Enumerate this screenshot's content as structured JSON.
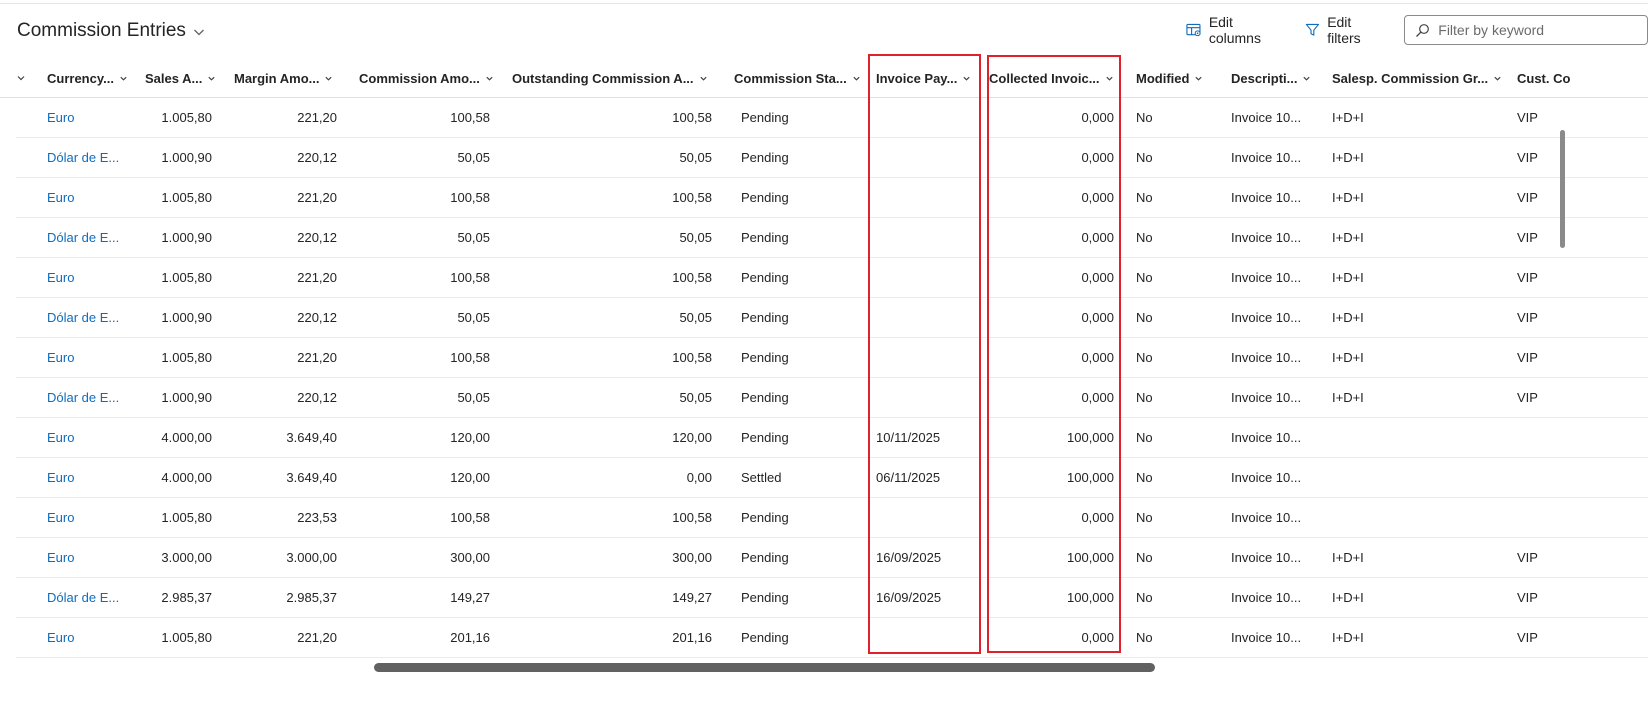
{
  "page": {
    "title": "Commission Entries"
  },
  "toolbar": {
    "edit_columns_label": "Edit columns",
    "edit_filters_label": "Edit filters",
    "filter_placeholder": "Filter by keyword",
    "filter_value": ""
  },
  "colors": {
    "link": "#0f6cbd",
    "highlight": "#e0212b"
  },
  "columns": [
    {
      "key": "currency",
      "label": "Currency..."
    },
    {
      "key": "sales",
      "label": "Sales A..."
    },
    {
      "key": "margin",
      "label": "Margin Amo..."
    },
    {
      "key": "commission",
      "label": "Commission Amo..."
    },
    {
      "key": "outstanding",
      "label": "Outstanding Commission A..."
    },
    {
      "key": "status",
      "label": "Commission Sta..."
    },
    {
      "key": "invoice_pay",
      "label": "Invoice Pay..."
    },
    {
      "key": "collected",
      "label": "Collected Invoic..."
    },
    {
      "key": "modified",
      "label": "Modified"
    },
    {
      "key": "description",
      "label": "Descripti..."
    },
    {
      "key": "group",
      "label": "Salesp. Commission Gr..."
    },
    {
      "key": "cust",
      "label": "Cust. Co"
    }
  ],
  "rows": [
    {
      "currency": "Euro",
      "sales": "1.005,80",
      "margin": "221,20",
      "commission": "100,58",
      "outstanding": "100,58",
      "status": "Pending",
      "invoice_pay": "",
      "collected": "0,000",
      "modified": "No",
      "description": "Invoice 10...",
      "group": "I+D+I",
      "cust": "VIP"
    },
    {
      "currency": "Dólar de E...",
      "sales": "1.000,90",
      "margin": "220,12",
      "commission": "50,05",
      "outstanding": "50,05",
      "status": "Pending",
      "invoice_pay": "",
      "collected": "0,000",
      "modified": "No",
      "description": "Invoice 10...",
      "group": "I+D+I",
      "cust": "VIP"
    },
    {
      "currency": "Euro",
      "sales": "1.005,80",
      "margin": "221,20",
      "commission": "100,58",
      "outstanding": "100,58",
      "status": "Pending",
      "invoice_pay": "",
      "collected": "0,000",
      "modified": "No",
      "description": "Invoice 10...",
      "group": "I+D+I",
      "cust": "VIP"
    },
    {
      "currency": "Dólar de E...",
      "sales": "1.000,90",
      "margin": "220,12",
      "commission": "50,05",
      "outstanding": "50,05",
      "status": "Pending",
      "invoice_pay": "",
      "collected": "0,000",
      "modified": "No",
      "description": "Invoice 10...",
      "group": "I+D+I",
      "cust": "VIP"
    },
    {
      "currency": "Euro",
      "sales": "1.005,80",
      "margin": "221,20",
      "commission": "100,58",
      "outstanding": "100,58",
      "status": "Pending",
      "invoice_pay": "",
      "collected": "0,000",
      "modified": "No",
      "description": "Invoice 10...",
      "group": "I+D+I",
      "cust": "VIP"
    },
    {
      "currency": "Dólar de E...",
      "sales": "1.000,90",
      "margin": "220,12",
      "commission": "50,05",
      "outstanding": "50,05",
      "status": "Pending",
      "invoice_pay": "",
      "collected": "0,000",
      "modified": "No",
      "description": "Invoice 10...",
      "group": "I+D+I",
      "cust": "VIP"
    },
    {
      "currency": "Euro",
      "sales": "1.005,80",
      "margin": "221,20",
      "commission": "100,58",
      "outstanding": "100,58",
      "status": "Pending",
      "invoice_pay": "",
      "collected": "0,000",
      "modified": "No",
      "description": "Invoice 10...",
      "group": "I+D+I",
      "cust": "VIP"
    },
    {
      "currency": "Dólar de E...",
      "sales": "1.000,90",
      "margin": "220,12",
      "commission": "50,05",
      "outstanding": "50,05",
      "status": "Pending",
      "invoice_pay": "",
      "collected": "0,000",
      "modified": "No",
      "description": "Invoice 10...",
      "group": "I+D+I",
      "cust": "VIP"
    },
    {
      "currency": "Euro",
      "sales": "4.000,00",
      "margin": "3.649,40",
      "commission": "120,00",
      "outstanding": "120,00",
      "status": "Pending",
      "invoice_pay": "10/11/2025",
      "collected": "100,000",
      "modified": "No",
      "description": "Invoice 10...",
      "group": "",
      "cust": ""
    },
    {
      "currency": "Euro",
      "sales": "4.000,00",
      "margin": "3.649,40",
      "commission": "120,00",
      "outstanding": "0,00",
      "status": "Settled",
      "invoice_pay": "06/11/2025",
      "collected": "100,000",
      "modified": "No",
      "description": "Invoice 10...",
      "group": "",
      "cust": ""
    },
    {
      "currency": "Euro",
      "sales": "1.005,80",
      "margin": "223,53",
      "commission": "100,58",
      "outstanding": "100,58",
      "status": "Pending",
      "invoice_pay": "",
      "collected": "0,000",
      "modified": "No",
      "description": "Invoice 10...",
      "group": "",
      "cust": ""
    },
    {
      "currency": "Euro",
      "sales": "3.000,00",
      "margin": "3.000,00",
      "commission": "300,00",
      "outstanding": "300,00",
      "status": "Pending",
      "invoice_pay": "16/09/2025",
      "collected": "100,000",
      "modified": "No",
      "description": "Invoice 10...",
      "group": "I+D+I",
      "cust": "VIP"
    },
    {
      "currency": "Dólar de E...",
      "sales": "2.985,37",
      "margin": "2.985,37",
      "commission": "149,27",
      "outstanding": "149,27",
      "status": "Pending",
      "invoice_pay": "16/09/2025",
      "collected": "100,000",
      "modified": "No",
      "description": "Invoice 10...",
      "group": "I+D+I",
      "cust": "VIP"
    },
    {
      "currency": "Euro",
      "sales": "1.005,80",
      "margin": "221,20",
      "commission": "201,16",
      "outstanding": "201,16",
      "status": "Pending",
      "invoice_pay": "",
      "collected": "0,000",
      "modified": "No",
      "description": "Invoice 10...",
      "group": "I+D+I",
      "cust": "VIP"
    }
  ]
}
